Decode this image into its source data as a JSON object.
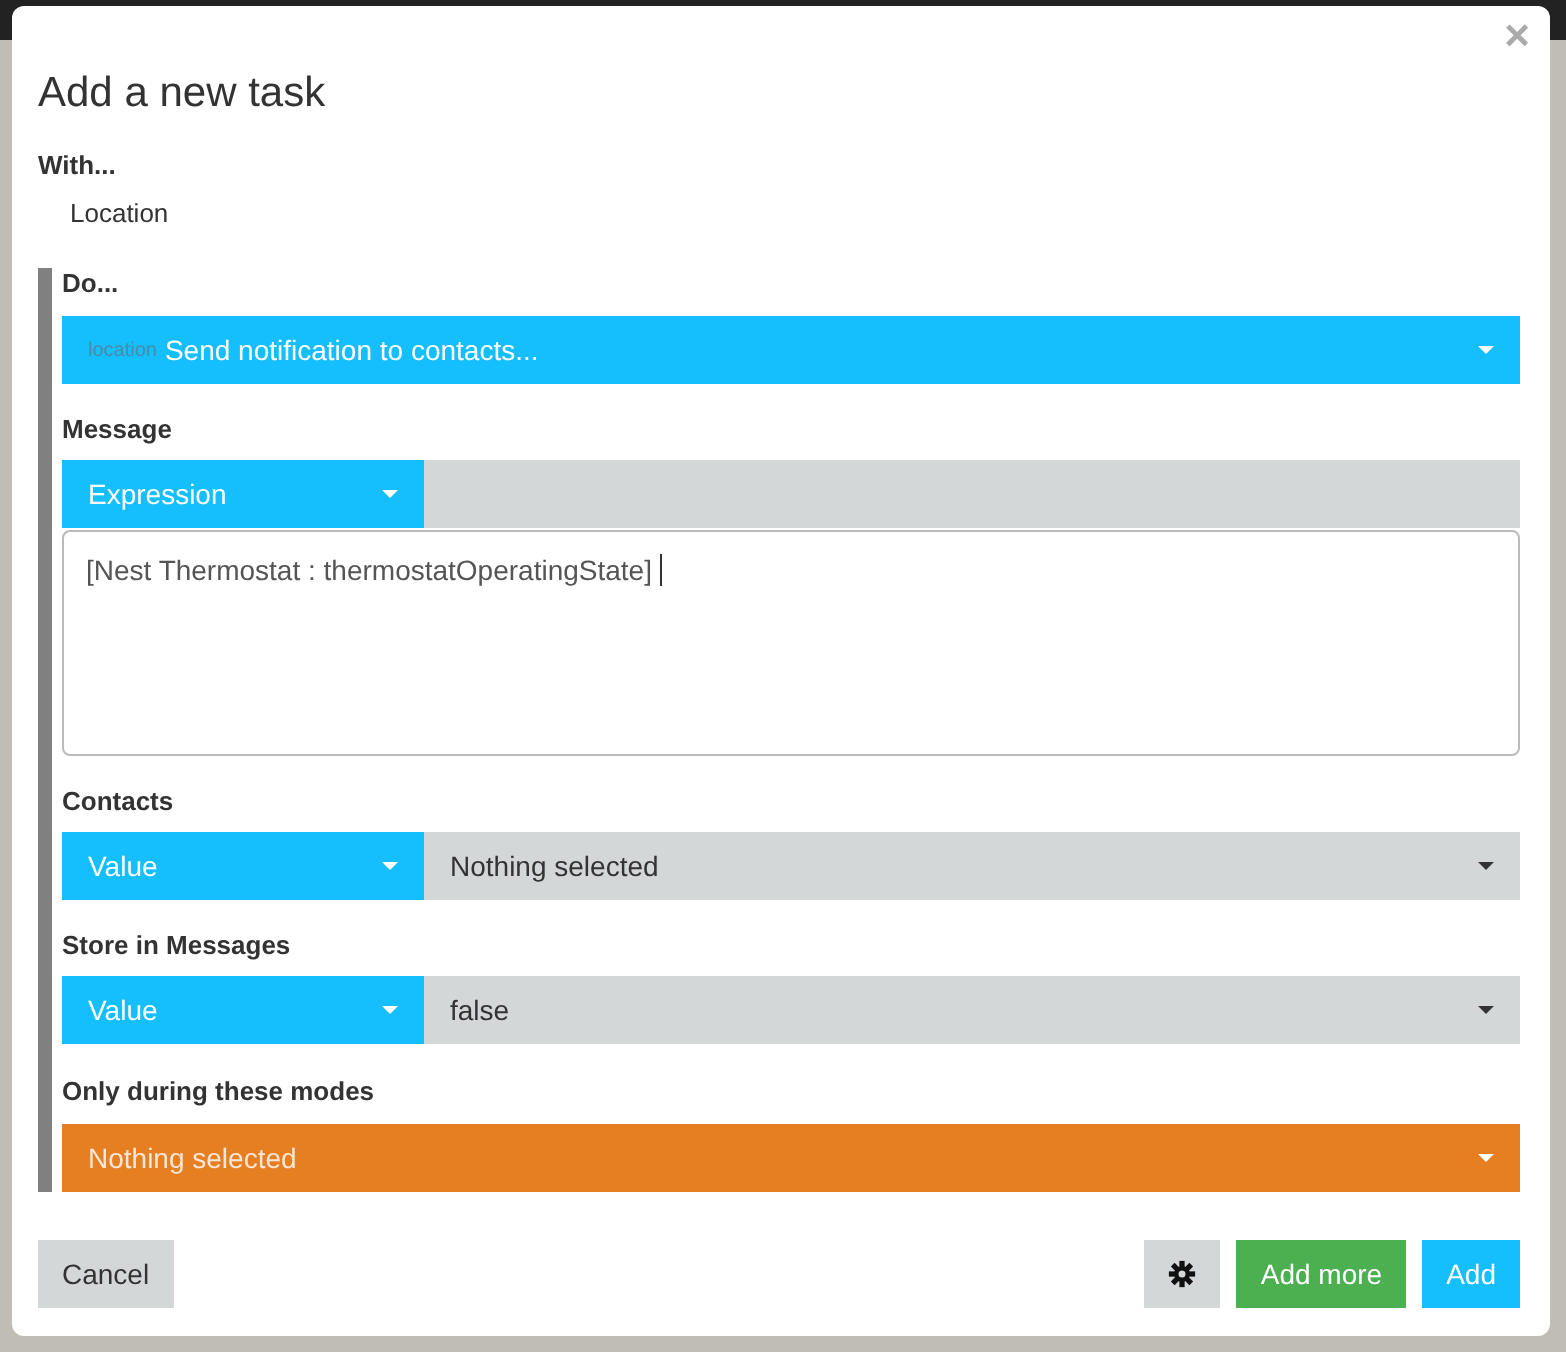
{
  "dialog": {
    "title": "Add a new task",
    "close": "×"
  },
  "with": {
    "label": "With...",
    "value": "Location"
  },
  "do": {
    "label": "Do...",
    "prefix": "location",
    "value": "Send notification to contacts..."
  },
  "fields": [
    {
      "kind": "expression",
      "label": "Message",
      "mode": "Expression",
      "value": "[Nest Thermostat : thermostatOperatingState]"
    },
    {
      "kind": "select",
      "label": "Contacts",
      "mode": "Value",
      "value": "Nothing selected"
    },
    {
      "kind": "select",
      "label": "Store in Messages",
      "mode": "Value",
      "value": "false"
    }
  ],
  "modes": {
    "label": "Only during these modes",
    "value": "Nothing selected"
  },
  "buttons": [
    {
      "kind": "cancel",
      "label": "Cancel"
    },
    {
      "kind": "settings"
    },
    {
      "kind": "add_more",
      "label": "Add more"
    },
    {
      "kind": "add",
      "label": "Add"
    }
  ]
}
